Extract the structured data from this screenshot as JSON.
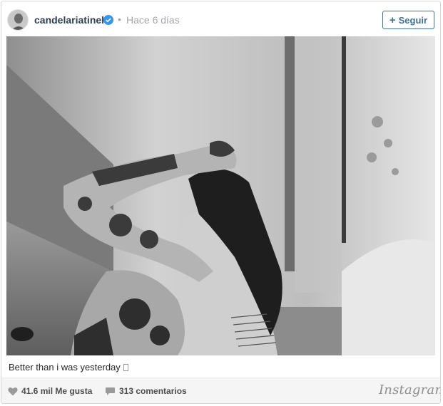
{
  "post": {
    "username": "candelariatinelli",
    "separator": "•",
    "time_ago": "Hace 6 días",
    "follow_label": "Seguir",
    "follow_icon": "+",
    "verified_icon": "verified-check-icon",
    "photo_alt": "post-photo",
    "caption": "Better than i was yesterday",
    "likes": "41.6 mil Me gusta",
    "comments": "313 comentarios",
    "brand": "Instagram"
  },
  "colors": {
    "link": "#3f729b",
    "username": "#2c3e50",
    "muted": "#a5a7aa",
    "verified": "#3897f0",
    "footer_bg": "#f5f5f5"
  }
}
